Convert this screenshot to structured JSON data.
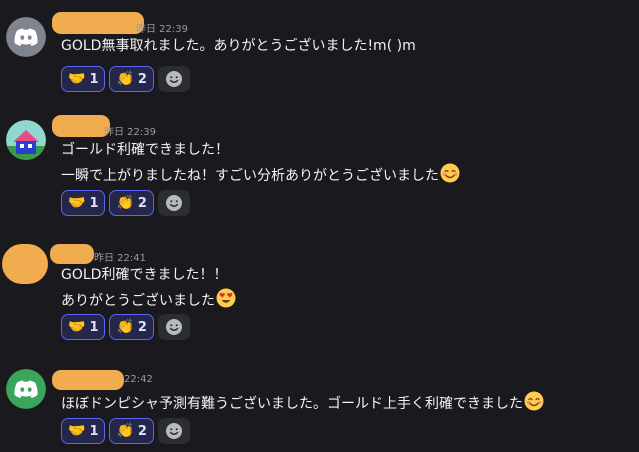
{
  "colors": {
    "background": "#1a1a1e",
    "accent": "#5865f2",
    "name_redaction": "#f0ac4e"
  },
  "messages": [
    {
      "avatar": "discord-default-gray-avatar",
      "timestamp": "昨日 22:39",
      "lines": [
        "GOLD無事取れました。ありがとうございました!m( )m"
      ],
      "reactions": [
        {
          "emoji": "handshake",
          "count": "1"
        },
        {
          "emoji": "clapping-hands",
          "count": "2"
        }
      ]
    },
    {
      "avatar": "custom-house-avatar",
      "timestamp": "昨日 22:39",
      "lines": [
        "ゴールド利確できました！",
        "一瞬で上がりましたね！すごい分析ありがとうございました"
      ],
      "reactions": [
        {
          "emoji": "handshake",
          "count": "1"
        },
        {
          "emoji": "clapping-hands",
          "count": "2"
        }
      ]
    },
    {
      "avatar": "redacted-avatar",
      "timestamp": "昨日 22:41",
      "lines": [
        "GOLD利確できました！！",
        "ありがとうございました"
      ],
      "reactions": [
        {
          "emoji": "handshake",
          "count": "1"
        },
        {
          "emoji": "clapping-hands",
          "count": "2"
        }
      ]
    },
    {
      "avatar": "discord-default-green-avatar",
      "timestamp": "22:42",
      "lines": [
        "ほぼドンピシャ予測有難うございました。ゴールド上手く利確できました"
      ],
      "reactions": [
        {
          "emoji": "handshake",
          "count": "1"
        },
        {
          "emoji": "clapping-hands",
          "count": "2"
        }
      ]
    }
  ]
}
